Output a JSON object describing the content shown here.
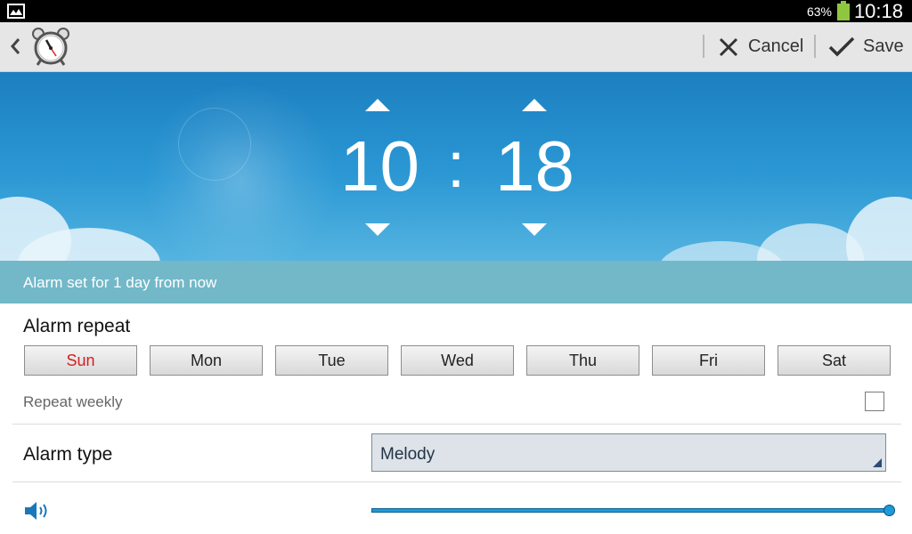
{
  "status_bar": {
    "battery_percent": "63%",
    "time": "10:18",
    "battery_color": "#8ec63f"
  },
  "action_bar": {
    "back_icon": "chevron-left-icon",
    "app_icon": "alarm-clock-icon",
    "cancel_label": "Cancel",
    "save_label": "Save"
  },
  "time_picker": {
    "hour": "10",
    "separator": ":",
    "minute": "18"
  },
  "info": {
    "message": "Alarm set for 1 day from now"
  },
  "alarm_repeat": {
    "title": "Alarm repeat",
    "days": [
      "Sun",
      "Mon",
      "Tue",
      "Wed",
      "Thu",
      "Fri",
      "Sat"
    ],
    "sunday_color": "#d21f1f",
    "repeat_weekly_label": "Repeat weekly",
    "repeat_weekly_checked": false
  },
  "alarm_type": {
    "title": "Alarm type",
    "selected": "Melody"
  },
  "volume": {
    "icon": "speaker-icon",
    "level": 1.0,
    "accent_color": "#1e9ad8"
  }
}
